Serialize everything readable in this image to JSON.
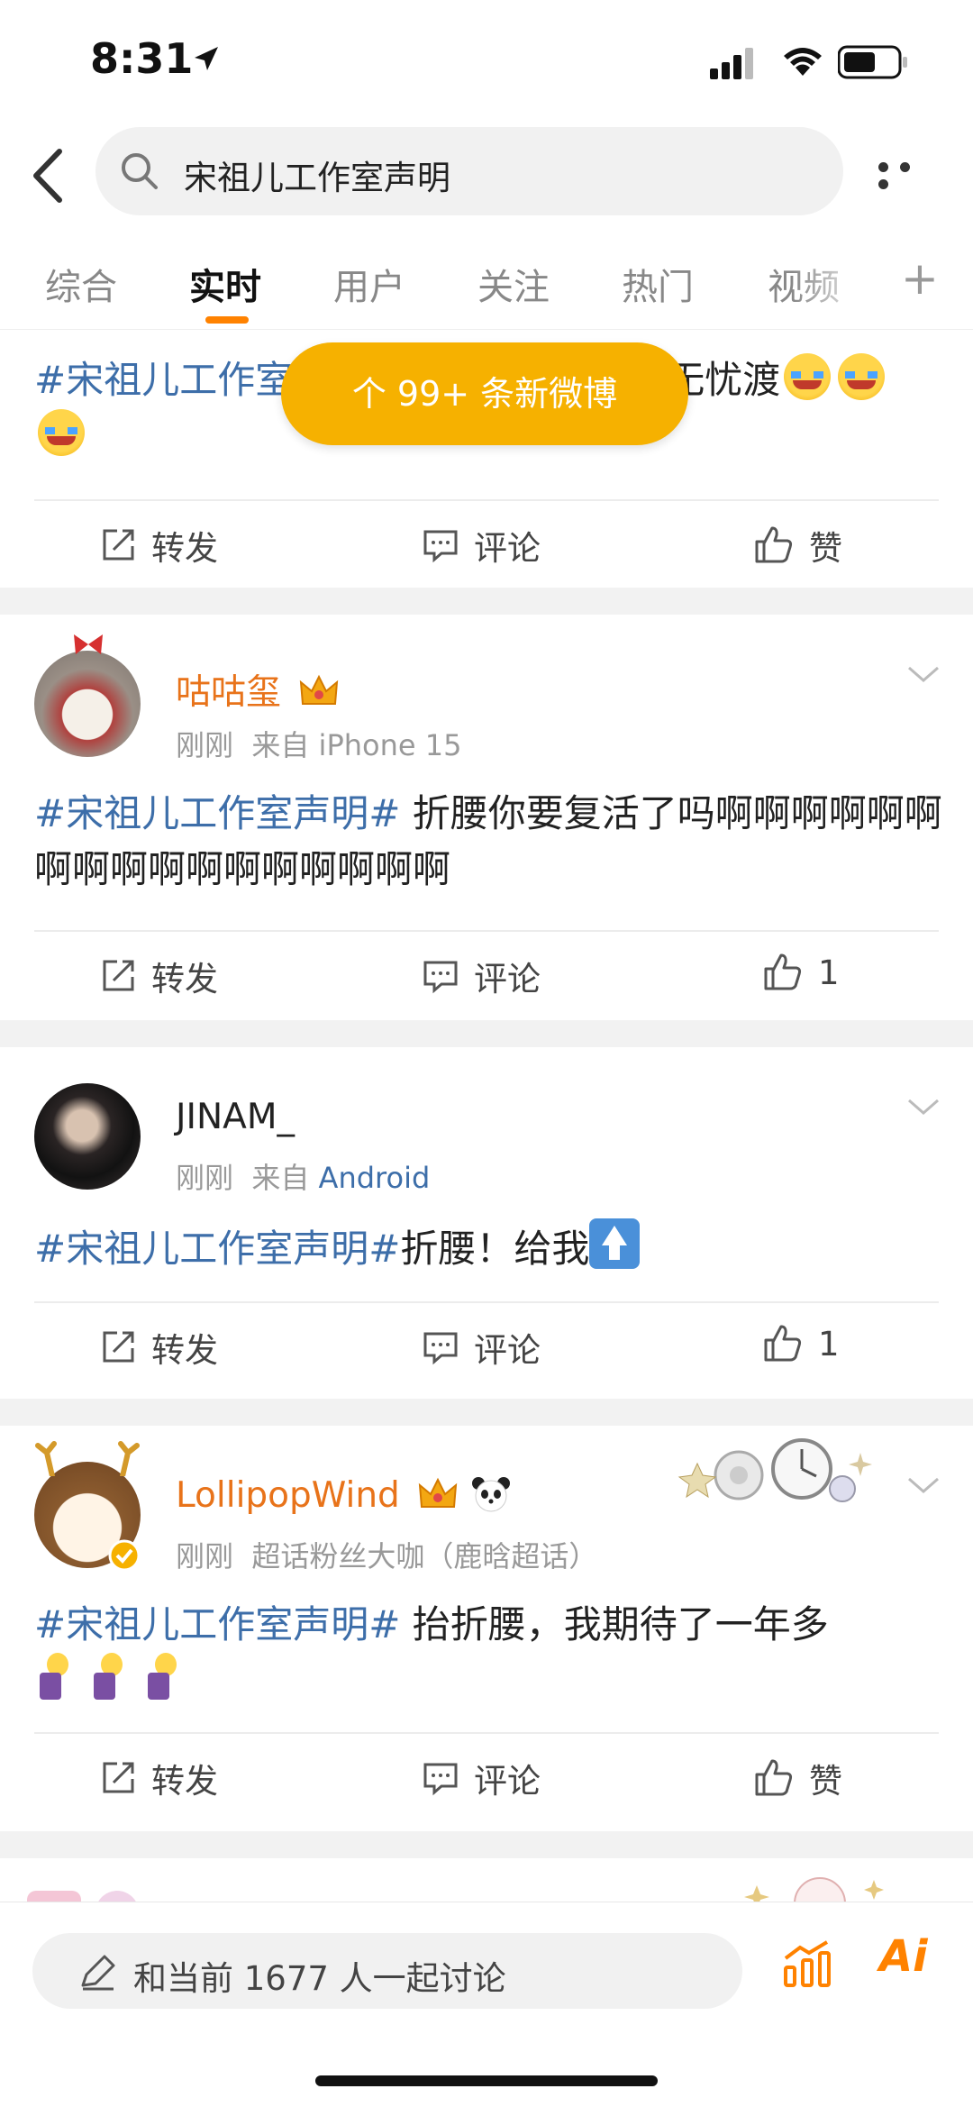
{
  "status_bar": {
    "time": "8:31"
  },
  "search": {
    "query": "宋祖儿工作室声明"
  },
  "tabs": [
    {
      "label": "综合"
    },
    {
      "label": "实时"
    },
    {
      "label": "用户"
    },
    {
      "label": "关注"
    },
    {
      "label": "热门"
    },
    {
      "label": "视频"
    }
  ],
  "new_posts_pill": "个 99+ 条新微博",
  "posts": [
    {
      "text_hashtag": "#宋祖儿工作室",
      "text_tail": "无忧渡",
      "actions": {
        "repost": "转发",
        "comment": "评论",
        "like": "赞"
      }
    },
    {
      "username": "咕咕玺",
      "time": "刚刚",
      "source_prefix": "来自",
      "source": "iPhone 15",
      "hashtag": "#宋祖儿工作室声明#",
      "text": " 折腰你要复活了吗啊啊啊啊啊啊啊啊啊啊啊啊啊啊啊啊啊",
      "actions": {
        "repost": "转发",
        "comment": "评论",
        "like": "1"
      }
    },
    {
      "username": "JINAM_",
      "time": "刚刚",
      "source_prefix": "来自",
      "source": "Android",
      "hashtag": "#宋祖儿工作室声明#",
      "text": "折腰！给我",
      "actions": {
        "repost": "转发",
        "comment": "评论",
        "like": "1"
      }
    },
    {
      "username": "LollipopWind",
      "time": "刚刚",
      "badge": "超话粉丝大咖（鹿晗超话）",
      "hashtag": "#宋祖儿工作室声明#",
      "text": " 抬折腰，我期待了一年多",
      "actions": {
        "repost": "转发",
        "comment": "评论",
        "like": "赞"
      }
    }
  ],
  "bottom": {
    "discuss_placeholder": "和当前 1677 人一起讨论",
    "ai_label": "Ai"
  },
  "colors": {
    "accent": "#ff8200",
    "link": "#3d6ea9",
    "pill": "#f6b100"
  }
}
